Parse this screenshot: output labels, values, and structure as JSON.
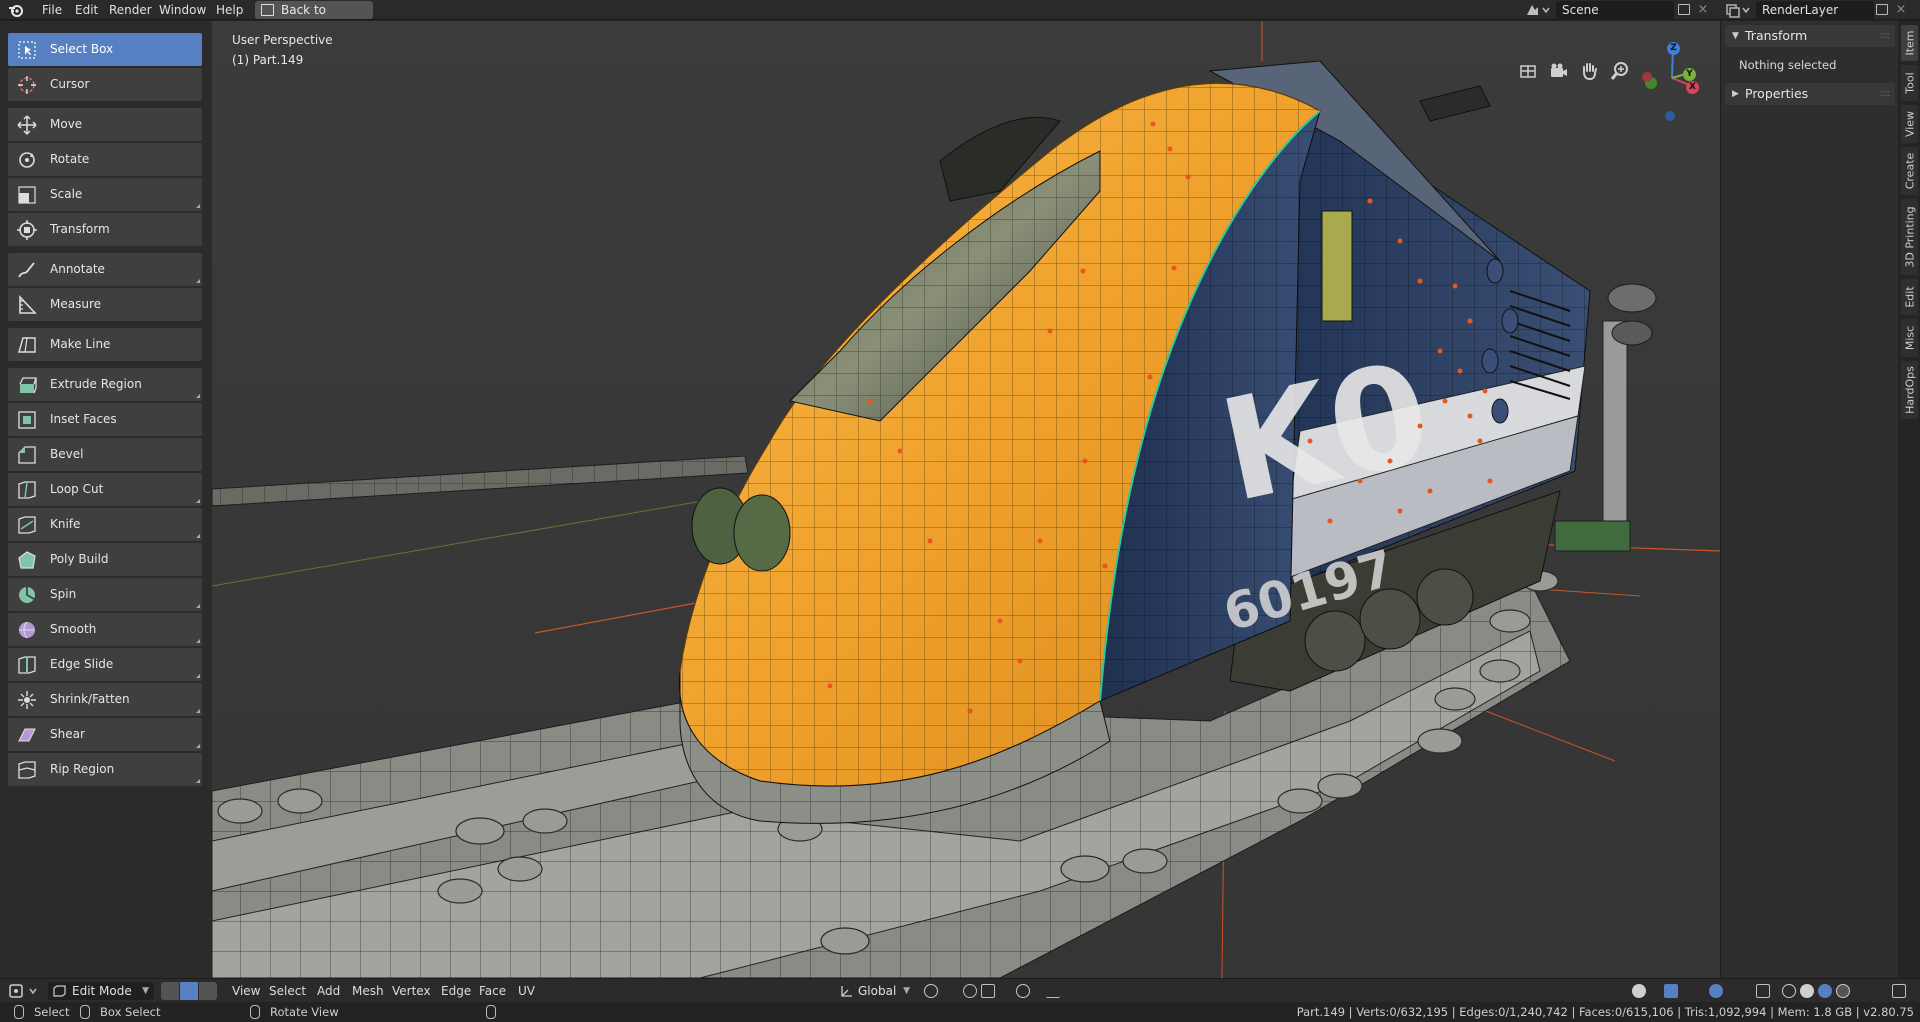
{
  "menu": [
    "File",
    "Edit",
    "Render",
    "Window",
    "Help"
  ],
  "back_button": "Back to Previous",
  "scene": "Scene",
  "render_layer": "RenderLayer",
  "viewport": {
    "perspective": "User Perspective",
    "object": "(1) Part.149",
    "gizmo_axes": {
      "z": "Z",
      "y": "Y",
      "x": "X"
    }
  },
  "tools": [
    {
      "label": "Select Box",
      "icon": "select-box-icon",
      "active": true
    },
    {
      "label": "Cursor",
      "icon": "cursor-icon"
    },
    {
      "label": "Move",
      "icon": "move-icon"
    },
    {
      "label": "Rotate",
      "icon": "rotate-icon"
    },
    {
      "label": "Scale",
      "icon": "scale-icon"
    },
    {
      "label": "Transform",
      "icon": "transform-icon"
    },
    {
      "label": "Annotate",
      "icon": "annotate-icon"
    },
    {
      "label": "Measure",
      "icon": "measure-icon"
    },
    {
      "label": "Make Line",
      "icon": "make-line-icon"
    },
    {
      "label": "Extrude Region",
      "icon": "extrude-region-icon"
    },
    {
      "label": "Inset Faces",
      "icon": "inset-faces-icon"
    },
    {
      "label": "Bevel",
      "icon": "bevel-icon"
    },
    {
      "label": "Loop Cut",
      "icon": "loop-cut-icon"
    },
    {
      "label": "Knife",
      "icon": "knife-icon"
    },
    {
      "label": "Poly Build",
      "icon": "poly-build-icon"
    },
    {
      "label": "Spin",
      "icon": "spin-icon"
    },
    {
      "label": "Smooth",
      "icon": "smooth-icon"
    },
    {
      "label": "Edge Slide",
      "icon": "edge-slide-icon"
    },
    {
      "label": "Shrink/Fatten",
      "icon": "shrink-fatten-icon"
    },
    {
      "label": "Shear",
      "icon": "shear-icon"
    },
    {
      "label": "Rip Region",
      "icon": "rip-region-icon"
    }
  ],
  "sidebar": {
    "transform": "Transform",
    "nothing_selected": "Nothing selected",
    "properties": "Properties",
    "tabs": [
      "Item",
      "Tool",
      "View",
      "Create",
      "3D Printing",
      "Edit",
      "Misc",
      "HardOps"
    ]
  },
  "header": {
    "mode": "Edit Mode",
    "menus": [
      "View",
      "Select",
      "Add",
      "Mesh",
      "Vertex",
      "Edge",
      "Face",
      "UV"
    ],
    "orientation": "Global"
  },
  "status": {
    "select": "Select",
    "box_select": "Box Select",
    "rotate_view": "Rotate View",
    "stats": "Part.149 | Verts:0/632,195 | Edges:0/1,240,742 | Faces:0/615,106 | Tris:1,092,994 | Mem: 1.8 GB | v2.80.75"
  },
  "colors": {
    "accent": "#5680c2",
    "train_yellow": "#f2a531",
    "train_blue": "#24375a"
  }
}
